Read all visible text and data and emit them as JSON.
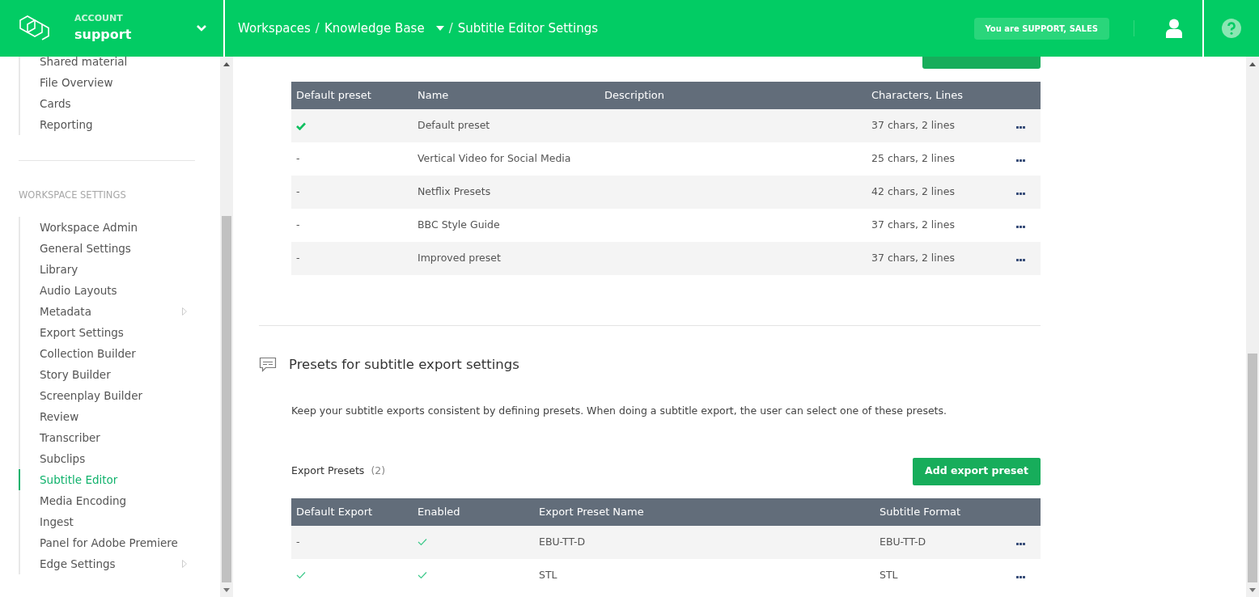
{
  "header": {
    "account_label": "ACCOUNT",
    "account_name": "support",
    "breadcrumb": [
      {
        "label": "Workspaces",
        "dropdown": false
      },
      {
        "label": "Knowledge Base",
        "dropdown": true,
        "separator": "/"
      },
      {
        "label": "Subtitle Editor Settings",
        "dropdown": false,
        "separator": "/"
      }
    ],
    "role_badge": "You are SUPPORT, SALES"
  },
  "sidebar": {
    "top_items": [
      {
        "label": "Shared material",
        "selected": false,
        "submenu": false
      },
      {
        "label": "File Overview",
        "selected": false,
        "submenu": false
      },
      {
        "label": "Cards",
        "selected": false,
        "submenu": false
      },
      {
        "label": "Reporting",
        "selected": false,
        "submenu": false
      }
    ],
    "section_title": "WORKSPACE SETTINGS",
    "items": [
      {
        "label": "Workspace Admin",
        "selected": false,
        "submenu": false
      },
      {
        "label": "General Settings",
        "selected": false,
        "submenu": false
      },
      {
        "label": "Library",
        "selected": false,
        "submenu": false
      },
      {
        "label": "Audio Layouts",
        "selected": false,
        "submenu": false
      },
      {
        "label": "Metadata",
        "selected": false,
        "submenu": true
      },
      {
        "label": "Export Settings",
        "selected": false,
        "submenu": false
      },
      {
        "label": "Collection Builder",
        "selected": false,
        "submenu": false
      },
      {
        "label": "Story Builder",
        "selected": false,
        "submenu": false
      },
      {
        "label": "Screenplay Builder",
        "selected": false,
        "submenu": false
      },
      {
        "label": "Review",
        "selected": false,
        "submenu": false
      },
      {
        "label": "Transcriber",
        "selected": false,
        "submenu": false
      },
      {
        "label": "Subclips",
        "selected": false,
        "submenu": false
      },
      {
        "label": "Subtitle Editor",
        "selected": true,
        "submenu": false
      },
      {
        "label": "Media Encoding",
        "selected": false,
        "submenu": false
      },
      {
        "label": "Ingest",
        "selected": false,
        "submenu": false
      },
      {
        "label": "Panel for Adobe Premiere",
        "selected": false,
        "submenu": false
      },
      {
        "label": "Edge Settings",
        "selected": false,
        "submenu": true
      }
    ]
  },
  "presets_table": {
    "columns": [
      "Default preset",
      "Name",
      "Description",
      "Characters, Lines"
    ],
    "rows": [
      {
        "default": true,
        "name": "Default preset",
        "chars_lines": "37 chars, 2 lines"
      },
      {
        "default": false,
        "default_label": "-",
        "name": "Vertical Video for Social Media",
        "chars_lines": "25 chars, 2 lines"
      },
      {
        "default": false,
        "default_label": "-",
        "name": "Netflix Presets",
        "chars_lines": "42 chars, 2 lines"
      },
      {
        "default": false,
        "default_label": "-",
        "name": "BBC Style Guide",
        "chars_lines": "37 chars, 2 lines"
      },
      {
        "default": false,
        "default_label": "-",
        "name": "Improved preset",
        "chars_lines": "37 chars, 2 lines"
      }
    ]
  },
  "export_section": {
    "title": "Presets for subtitle export settings",
    "description": "Keep your subtitle exports consistent by defining presets. When doing a subtitle export, the user can select one of these presets.",
    "list_title": "Export Presets",
    "count": "(2)",
    "add_button": "Add export preset",
    "table": {
      "columns": [
        "Default Export",
        "Enabled",
        "Export Preset Name",
        "Subtitle Format"
      ],
      "rows": [
        {
          "default": false,
          "default_label": "-",
          "enabled": true,
          "name": "EBU-TT-D",
          "format": "EBU-TT-D"
        },
        {
          "default": true,
          "enabled": true,
          "name": "STL",
          "format": "STL"
        }
      ]
    }
  }
}
